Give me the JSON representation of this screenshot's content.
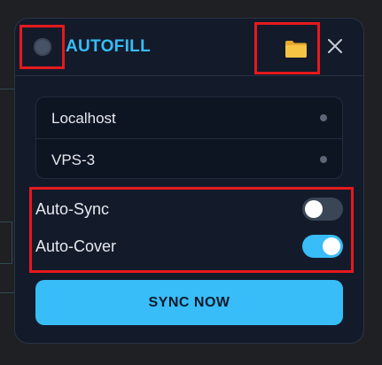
{
  "header": {
    "title": "AUTOFILL",
    "status_icon": "status-dot-icon",
    "folder_icon": "folder-icon",
    "close_icon": "close-icon"
  },
  "servers": [
    {
      "name": "Localhost"
    },
    {
      "name": "VPS-3"
    }
  ],
  "settings": {
    "auto_sync": {
      "label": "Auto-Sync",
      "enabled": false
    },
    "auto_cover": {
      "label": "Auto-Cover",
      "enabled": true
    }
  },
  "actions": {
    "sync_now_label": "SYNC NOW"
  },
  "colors": {
    "accent": "#38bdf8",
    "panel_bg": "#131b2b",
    "highlight": "#e5191c",
    "folder": "#f6c445"
  }
}
